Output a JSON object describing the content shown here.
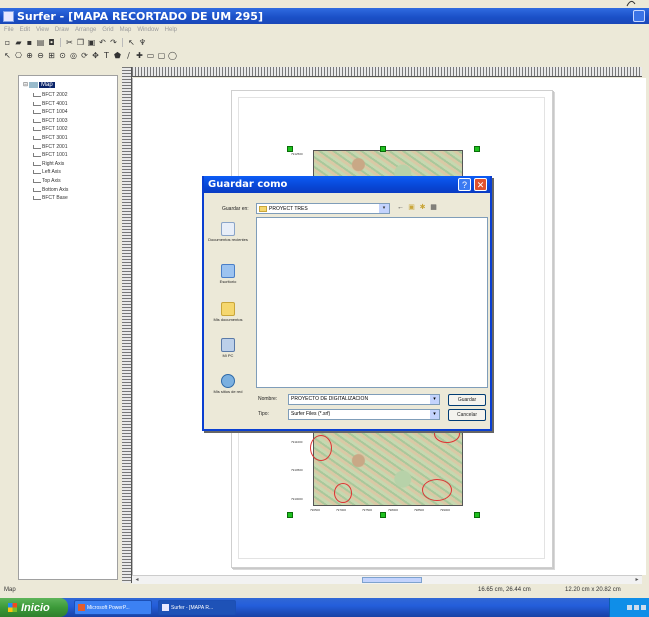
{
  "window": {
    "title": "Surfer - [MAPA RECORTADO DE UM 295]"
  },
  "menu": [
    "File",
    "Edit",
    "View",
    "Draw",
    "Arrange",
    "Grid",
    "Map",
    "Window",
    "Help"
  ],
  "object_manager": {
    "root": "Map",
    "items": [
      "BFCT 2002",
      "BFCT 4001",
      "BFCT 1004",
      "BFCT 1003",
      "BFCT 1002",
      "BFCT 3001",
      "BFCT 2001",
      "BFCT 1001",
      "Right Axis",
      "Left Axis",
      "Top Axis",
      "Bottom Axis",
      "BFCT Base"
    ]
  },
  "map": {
    "y_ticks": [
      "7911000",
      "7910500",
      "7910000"
    ],
    "x_ticks": [
      "796500",
      "797000",
      "797500",
      "798000",
      "798500",
      "799000"
    ],
    "top_label": "7912500"
  },
  "dialog": {
    "title": "Guardar como",
    "save_in_label": "Guardar en:",
    "folder": "PROYECT TRES",
    "places": [
      "Documentos recientes",
      "Escritorio",
      "Mis documentos",
      "Mi PC",
      "Mis sitios de red"
    ],
    "name_label": "Nombre:",
    "name_value": "PROYECTO DE DIGITALIZACION",
    "type_label": "Tipo:",
    "type_value": "Surfer Files (*.srf)",
    "save_button": "Guardar",
    "cancel_button": "Cancelar"
  },
  "status": {
    "left": "Map",
    "position": "16.65 cm, 26.44 cm",
    "size": "12.20 cm x 20.82 cm"
  },
  "taskbar": {
    "start": "Inicio",
    "tasks": [
      "Microsoft PowerP...",
      "Surfer - [MAPA R..."
    ]
  },
  "colors": {
    "handle": "#1fc11f",
    "title_blue": "#0846d6",
    "contour_red": "#dd3333"
  }
}
